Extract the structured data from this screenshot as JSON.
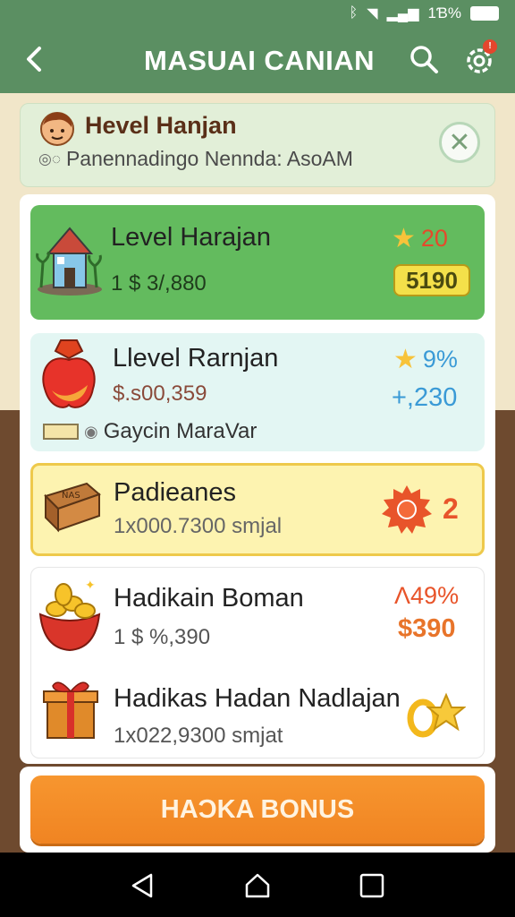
{
  "status_bar": {
    "time": "1Ɓ%",
    "icons": [
      "signal-icon",
      "wifi-icon",
      "battery-icon"
    ]
  },
  "app_bar": {
    "title": "MASUAI CANIAN",
    "notification_count": "!"
  },
  "profile": {
    "name": "Hevel Hanjan",
    "subtitle": "Panennadingo Nennda: AsoAM"
  },
  "cards": {
    "green": {
      "title": "Level Harajan",
      "value": "1 $ 3/,880",
      "star_value": "20",
      "badge": "5190",
      "icon": "house-icon"
    },
    "teal": {
      "title": "Llevel Rarnjan",
      "value": "$.s00,359",
      "star_value": "9%",
      "plus_value": "+,230",
      "footer_label": "Gaycin MaraVar",
      "icon": "apple-icon"
    },
    "yellow": {
      "title": "Padieanes",
      "value": "1x000.7300 smjal",
      "badge_value": "2",
      "icon": "chest-icon",
      "chest_label": "NAS"
    },
    "white_1": {
      "title": "Hadikain Boman",
      "value": "1 $ %,390",
      "pct": "Ʌ49%",
      "amount": "$390",
      "icon": "coin-bowl-icon"
    },
    "white_2": {
      "title": "Hadikas Hadan Nadlajan",
      "value": "1x022,9300 smjat",
      "icon": "gift-icon"
    }
  },
  "bonus_button": {
    "label": "HAƆKA BONUS"
  },
  "colors": {
    "app_bar": "#5b8f62",
    "green_card": "#63bb5e",
    "teal_card": "#e3f6f3",
    "yellow_card": "#fdf3b0",
    "button": "#f08422"
  }
}
